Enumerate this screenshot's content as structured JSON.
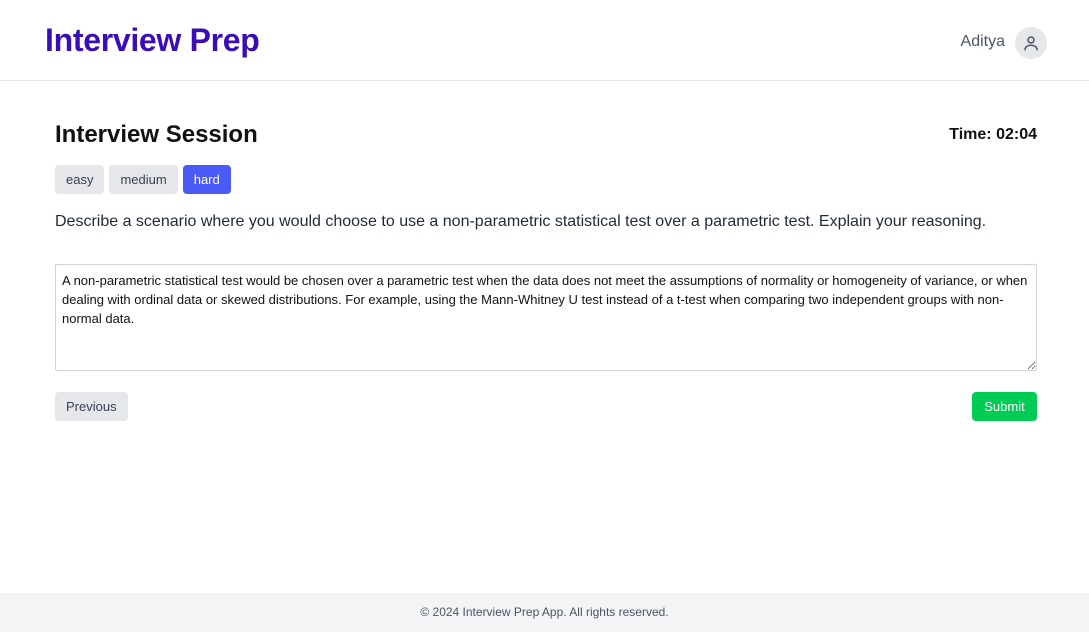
{
  "header": {
    "brand": "Interview Prep",
    "user_name": "Aditya",
    "avatar_icon": "user-icon"
  },
  "session": {
    "title": "Interview Session",
    "timer": "Time: 02:04",
    "difficulty_options": [
      {
        "label": "easy",
        "selected": false
      },
      {
        "label": "medium",
        "selected": false
      },
      {
        "label": "hard",
        "selected": true
      }
    ],
    "question": "Describe a scenario where you would choose to use a non-parametric statistical test over a parametric test. Explain your reasoning.",
    "answer": "A non-parametric statistical test would be chosen over a parametric test when the data does not meet the assumptions of normality or homogeneity of variance, or when dealing with ordinal data or skewed distributions. For example, using the Mann-Whitney U test instead of a t-test when comparing two independent groups with non-normal data.",
    "previous_label": "Previous",
    "submit_label": "Submit"
  },
  "footer": {
    "text": "© 2024 Interview Prep App. All rights reserved."
  },
  "colors": {
    "brand": "#3b0db8",
    "selected_difficulty": "#4a5af7",
    "submit": "#00cc55",
    "neutral_button": "#e5e7eb"
  }
}
